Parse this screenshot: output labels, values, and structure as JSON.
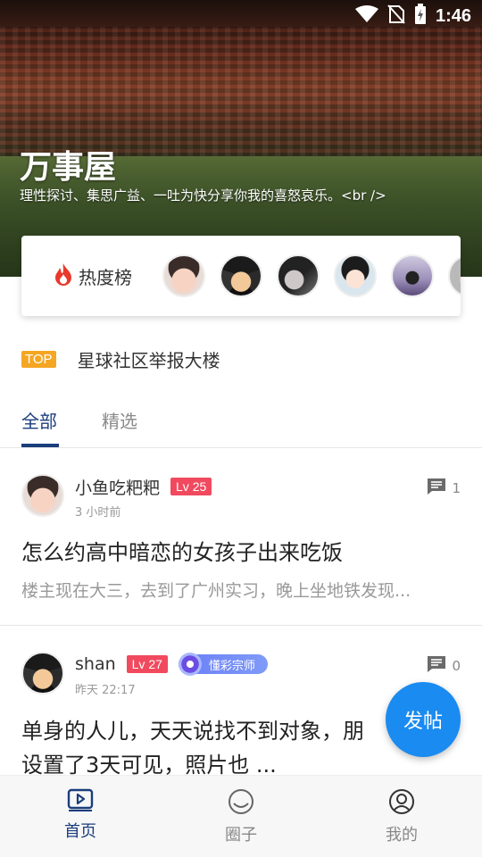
{
  "status_bar": {
    "time": "1:46",
    "icons": [
      "wifi-icon",
      "no-sim-icon",
      "battery-charging-icon"
    ]
  },
  "banner": {
    "title": "万事屋",
    "subtitle": "理性探讨、集思广益、一吐为快分享你我的喜怒哀乐。<br />"
  },
  "hot_list": {
    "label": "热度榜",
    "icon": "fire-icon",
    "avatars": [
      "avatar-1",
      "avatar-2",
      "avatar-3",
      "avatar-4",
      "avatar-5",
      "avatar-6"
    ]
  },
  "pinned": {
    "badge": "TOP",
    "text": "星球社区举报大楼"
  },
  "tabs": [
    {
      "label": "全部",
      "active": true
    },
    {
      "label": "精选",
      "active": false
    }
  ],
  "posts": [
    {
      "username": "小鱼吃粑粑",
      "level": "Lv 25",
      "time": "3 小时前",
      "comments": "1",
      "title": "怎么约高中暗恋的女孩子出来吃饭",
      "excerpt": "楼主现在大三，去到了广州实习，晚上坐地铁发现..."
    },
    {
      "username": "shan",
      "level": "Lv 27",
      "medal": "懂彩宗师",
      "time": "昨天 22:17",
      "comments": "0",
      "title_line1": "单身的人儿，天天说找不到对象，朋",
      "title_line2": "设置了3天可见，照片也 ..."
    }
  ],
  "fab": {
    "label": "发帖"
  },
  "bottom_nav": [
    {
      "label": "首页",
      "icon": "home-play-icon",
      "active": true
    },
    {
      "label": "圈子",
      "icon": "circle-chat-icon",
      "active": false
    },
    {
      "label": "我的",
      "icon": "profile-icon",
      "active": false
    }
  ],
  "colors": {
    "accent": "#1a3d7c",
    "fab": "#1a8bf0",
    "level_badge": "#f14a5f",
    "top_badge": "#f5a623"
  }
}
